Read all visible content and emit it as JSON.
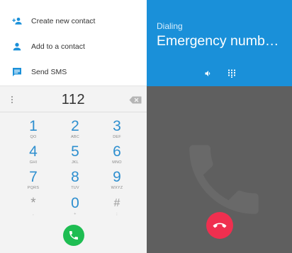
{
  "contact_actions": [
    {
      "label": "Create new contact",
      "icon": "add-person-icon"
    },
    {
      "label": "Add to a contact",
      "icon": "person-icon"
    },
    {
      "label": "Send SMS",
      "icon": "message-icon"
    }
  ],
  "dialpad": {
    "number": "112",
    "keys": [
      {
        "digit": "1",
        "letters": "QO"
      },
      {
        "digit": "2",
        "letters": "ABC"
      },
      {
        "digit": "3",
        "letters": "DEF"
      },
      {
        "digit": "4",
        "letters": "GHI"
      },
      {
        "digit": "5",
        "letters": "JKL"
      },
      {
        "digit": "6",
        "letters": "MNO"
      },
      {
        "digit": "7",
        "letters": "PQRS"
      },
      {
        "digit": "8",
        "letters": "TUV"
      },
      {
        "digit": "9",
        "letters": "WXYZ"
      },
      {
        "digit": "*",
        "letters": ","
      },
      {
        "digit": "0",
        "letters": "+"
      },
      {
        "digit": "#",
        "letters": ";"
      }
    ]
  },
  "call": {
    "status": "Dialing",
    "name": "Emergency numb…"
  },
  "colors": {
    "accent_blue": "#1a90d9",
    "digit_blue": "#2e8fcf",
    "call_green": "#1ebd52",
    "end_red": "#ef2f4f",
    "in_call_bg": "#5f5f5f"
  }
}
